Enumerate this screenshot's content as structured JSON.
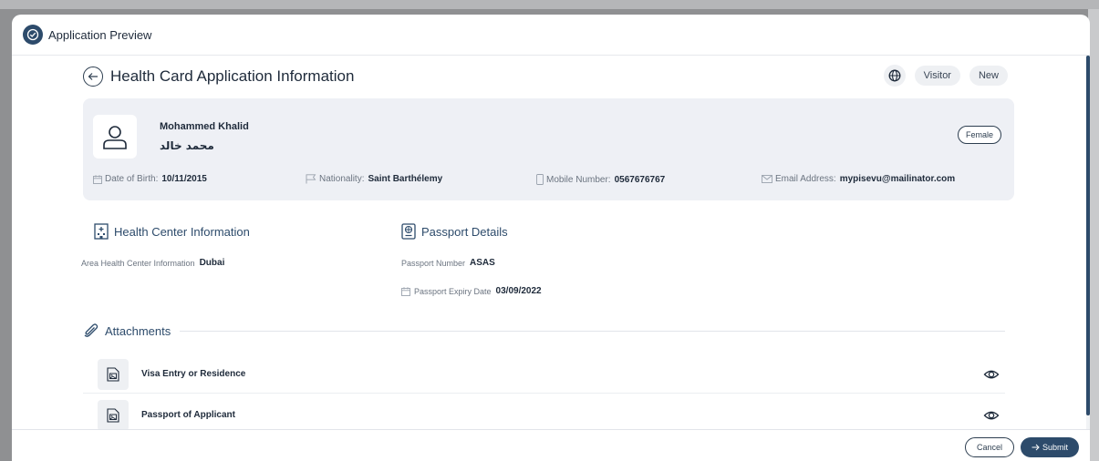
{
  "window": {
    "title": "Application Preview"
  },
  "header": {
    "title": "Health Card Application Information",
    "chips": [
      "Visitor",
      "New"
    ]
  },
  "profile": {
    "name_en": "Mohammed Khalid",
    "name_ar": "محمد خالد",
    "gender": "Female",
    "dob_label": "Date of Birth:",
    "dob": "10/11/2015",
    "nationality_label": "Nationality:",
    "nationality": "Saint Barthélemy",
    "mobile_label": "Mobile Number:",
    "mobile": "0567676767",
    "email_label": "Email Address:",
    "email": "mypisevu@mailinator.com"
  },
  "health_center": {
    "title": "Health Center Information",
    "area_label": "Area Health Center Information",
    "area": "Dubai"
  },
  "passport": {
    "title": "Passport Details",
    "number_label": "Passport Number",
    "number": "ASAS",
    "expiry_label": "Passport Expiry Date",
    "expiry": "03/09/2022"
  },
  "attachments": {
    "title": "Attachments",
    "items": [
      {
        "label": "Visa Entry or Residence"
      },
      {
        "label": "Passport of Applicant"
      }
    ]
  },
  "footer": {
    "cancel_label": "Cancel",
    "submit_label": "Submit"
  },
  "colors": {
    "primary": "#2d4b6b",
    "card_bg": "#eef0f5",
    "chip_bg": "#eef0f3"
  }
}
